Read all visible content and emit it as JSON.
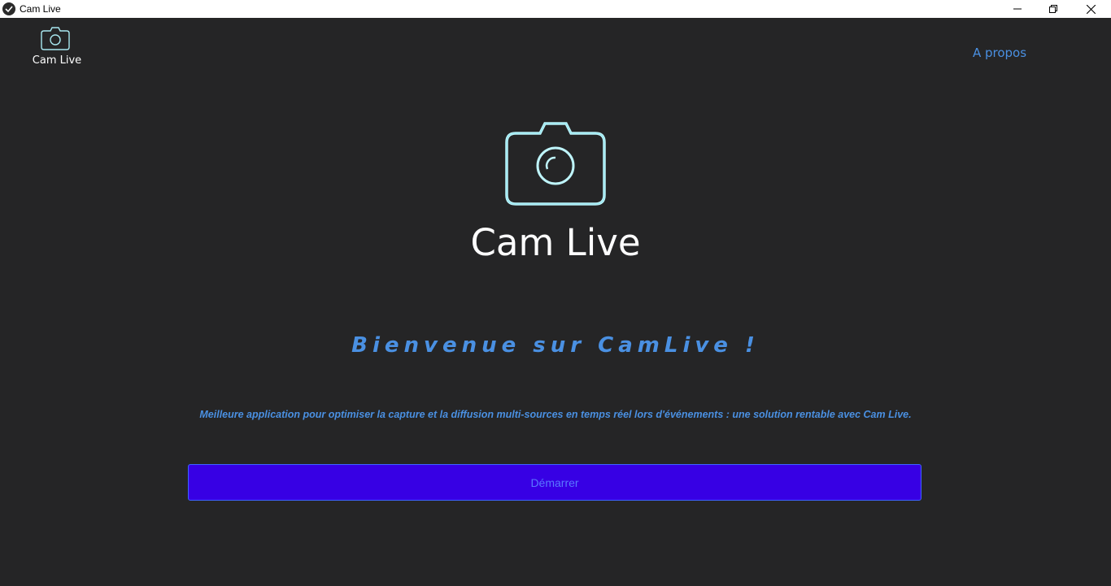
{
  "window": {
    "title": "Cam Live",
    "controls": {
      "minimize_icon": "minimize-icon",
      "maximize_icon": "restore-icon",
      "close_icon": "close-icon"
    }
  },
  "header": {
    "logo_label": "Cam Live",
    "about_link": "A propos"
  },
  "hero": {
    "icon": "camera-icon",
    "title": "Cam Live",
    "welcome": "Bienvenue sur CamLive !",
    "tagline": "Meilleure application pour optimiser la capture et la diffusion multi-sources en temps réel lors d'événements : une solution rentable avec Cam Live.",
    "start_button": "Démarrer"
  },
  "colors": {
    "background": "#252526",
    "accent_blue": "#4a90e2",
    "button_bg": "#3700e4",
    "icon_cyan": "#a8e8f0"
  }
}
